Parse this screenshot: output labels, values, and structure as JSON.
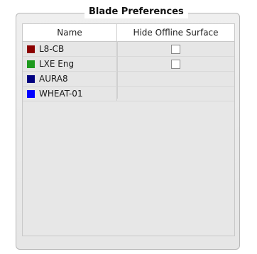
{
  "panel": {
    "title": "Blade Preferences"
  },
  "table": {
    "columns": [
      "Name",
      "Hide Offline Surface"
    ],
    "rows": [
      {
        "name": "L8-CB",
        "color": "#8b0000",
        "has_checkbox": true,
        "checked": false
      },
      {
        "name": "LXE Eng",
        "color": "#1e9a1e",
        "has_checkbox": true,
        "checked": false
      },
      {
        "name": "AURA8",
        "color": "#000080",
        "has_checkbox": false
      },
      {
        "name": "WHEAT-01",
        "color": "#0000ff",
        "has_checkbox": false
      }
    ]
  }
}
